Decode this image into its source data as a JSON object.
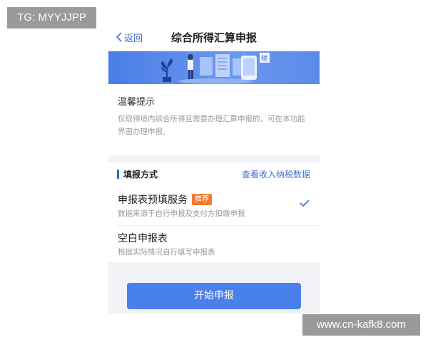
{
  "watermarks": {
    "top": "TG: MYYJJPP",
    "bottom": "www.cn-kafk8.com"
  },
  "nav": {
    "back_label": "返回",
    "title": "综合所得汇算申报"
  },
  "banner": {
    "sign_text": "税"
  },
  "tips": {
    "title": "温馨提示",
    "body": "仅取得境内综合所得且需要办理汇算申报的，可在本功能界面办理申报。"
  },
  "fill_method": {
    "title": "填报方式",
    "link": "查看收入纳税数据",
    "options": [
      {
        "title": "申报表预填服务",
        "badge": "推荐",
        "subtitle": "数据来源于自行申报及支付方扣缴申报",
        "selected": true
      },
      {
        "title": "空白申报表",
        "subtitle": "根据实际情况自行填写申报表",
        "selected": false
      }
    ]
  },
  "start_button": {
    "label": "开始申报"
  },
  "colors": {
    "accent": "#3b6fd6",
    "button": "#4a80ec",
    "badge": "#f07b2f"
  }
}
